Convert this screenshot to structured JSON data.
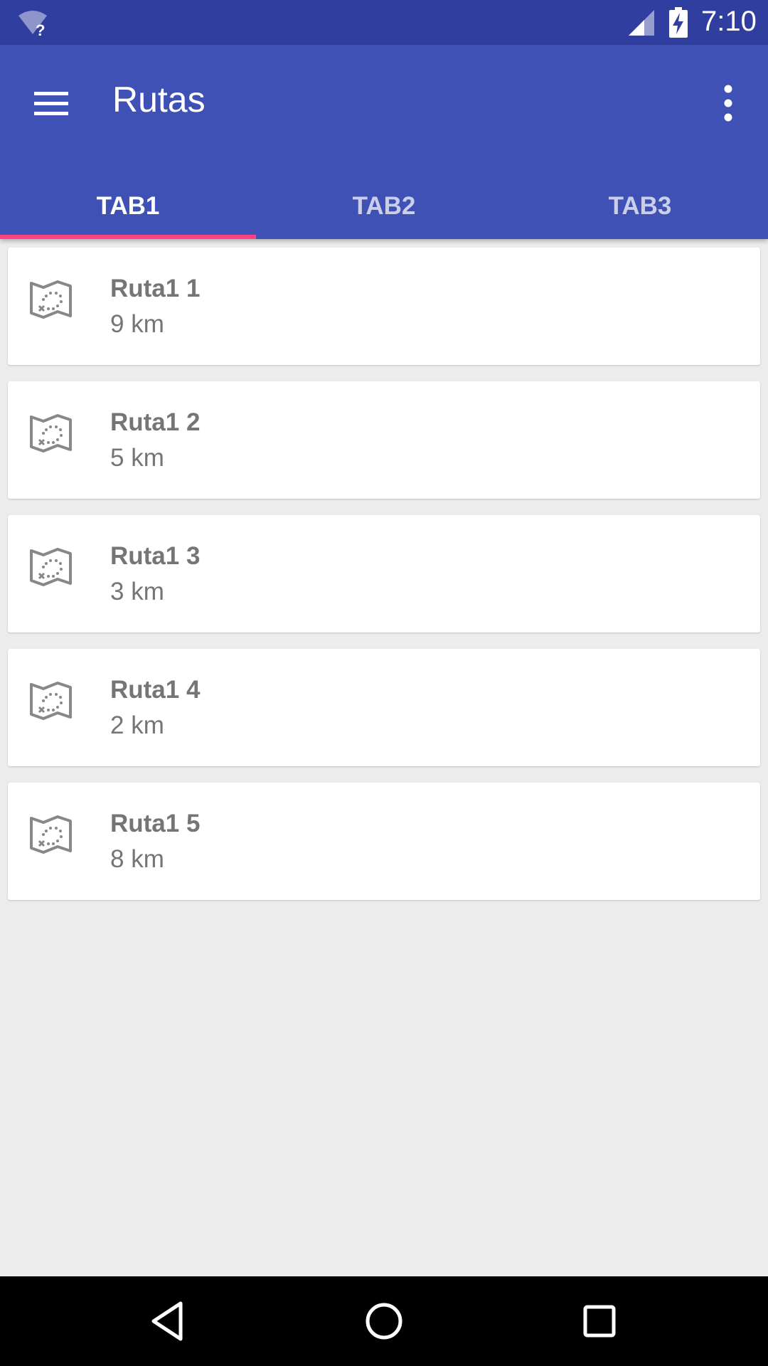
{
  "status_bar": {
    "time": "7:10",
    "wifi_unknown_mark": "?",
    "icons": [
      "wifi-unknown-icon",
      "signal-icon",
      "battery-charging-icon"
    ]
  },
  "app_bar": {
    "title": "Rutas",
    "icons": [
      "menu-icon",
      "overflow-menu-icon"
    ],
    "background_color": "#3f51b5"
  },
  "tabs": [
    {
      "label": "TAB1",
      "active": true
    },
    {
      "label": "TAB2",
      "active": false
    },
    {
      "label": "TAB3",
      "active": false
    }
  ],
  "accent_color": "#ff4081",
  "routes": [
    {
      "name": "Ruta1 1",
      "distance": "9 km",
      "icon": "map-icon"
    },
    {
      "name": "Ruta1 2",
      "distance": "5 km",
      "icon": "map-icon"
    },
    {
      "name": "Ruta1 3",
      "distance": "3 km",
      "icon": "map-icon"
    },
    {
      "name": "Ruta1 4",
      "distance": "2 km",
      "icon": "map-icon"
    },
    {
      "name": "Ruta1 5",
      "distance": "8 km",
      "icon": "map-icon"
    }
  ],
  "nav_bar": {
    "buttons": [
      "back-icon",
      "home-icon",
      "recents-icon"
    ]
  }
}
